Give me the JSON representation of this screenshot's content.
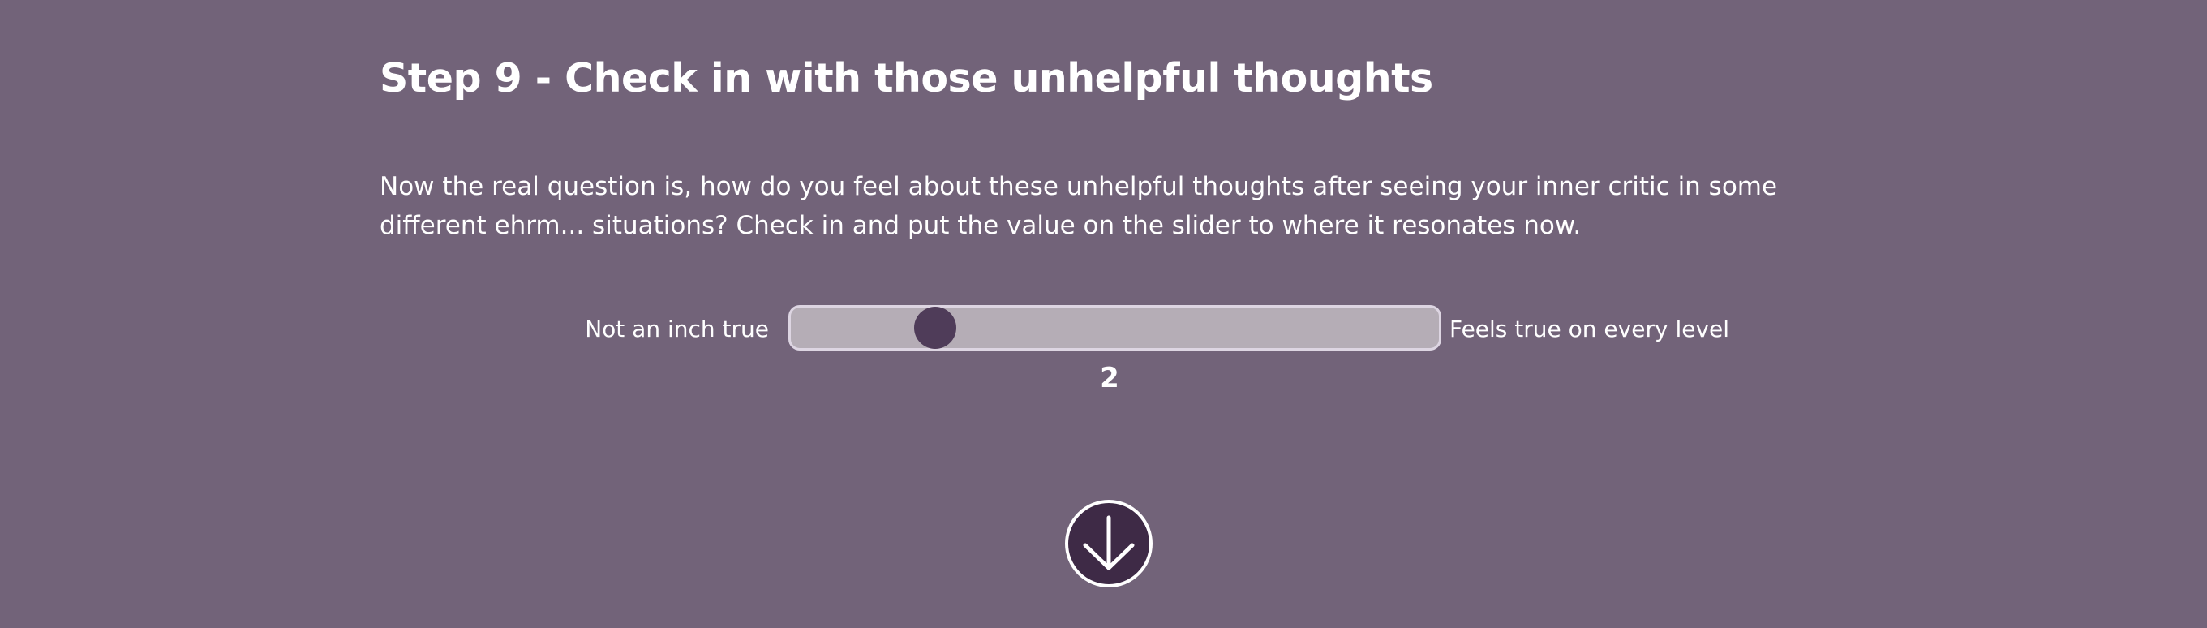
{
  "step": {
    "title": "Step 9 - Check in with those unhelpful thoughts",
    "body_line1": "Now the real question is, how do you feel about these unhelpful thoughts after seeing your inner critic in some",
    "body_line2": "different ehrm... situations? Check in and put the value on the slider to where it resonates now."
  },
  "slider": {
    "label_min": "Not an inch true",
    "label_max": "Feels true on every level",
    "value": "2",
    "min": 0,
    "max": 10,
    "aria_label": "How true the unhelpful thoughts feel"
  },
  "next_button": {
    "icon": "arrow-down-icon",
    "aria_label": "Next step"
  },
  "colors": {
    "background": "#726379",
    "track": "#b5adb6",
    "track_border": "#ddd5e2",
    "thumb": "#4f3c59",
    "button": "#3e2a46",
    "text": "#ffffff"
  }
}
